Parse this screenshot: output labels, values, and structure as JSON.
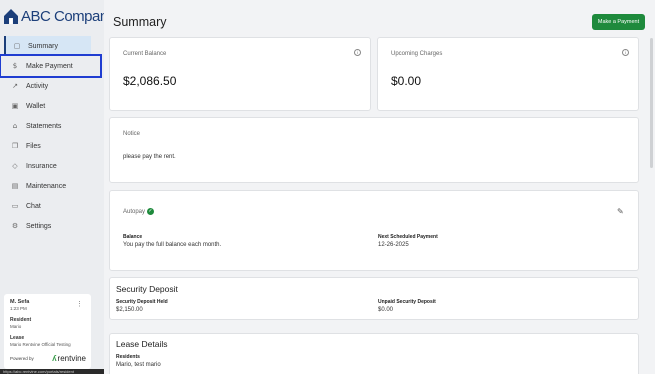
{
  "brand": {
    "name": "ABC Company",
    "color": "#1c3f7a"
  },
  "nav": [
    {
      "label": "Summary",
      "icon": "document-icon",
      "glyph": "▢",
      "state": "active"
    },
    {
      "label": "Make Payment",
      "icon": "dollar-circle-icon",
      "glyph": "$",
      "state": "focused"
    },
    {
      "label": "Activity",
      "icon": "trend-line-icon",
      "glyph": "↗",
      "state": ""
    },
    {
      "label": "Wallet",
      "icon": "wallet-icon",
      "glyph": "▣",
      "state": ""
    },
    {
      "label": "Statements",
      "icon": "bank-icon",
      "glyph": "⌂",
      "state": ""
    },
    {
      "label": "Files",
      "icon": "files-icon",
      "glyph": "❐",
      "state": ""
    },
    {
      "label": "Insurance",
      "icon": "shield-icon",
      "glyph": "◇",
      "state": ""
    },
    {
      "label": "Maintenance",
      "icon": "toolbox-icon",
      "glyph": "▤",
      "state": ""
    },
    {
      "label": "Chat",
      "icon": "chat-icon",
      "glyph": "▭",
      "state": ""
    },
    {
      "label": "Settings",
      "icon": "settings-icon",
      "glyph": "⚙",
      "state": ""
    }
  ],
  "user": {
    "name": "M. Sefa",
    "time": "1:23 PM",
    "resident_label": "Resident",
    "resident": "Mario",
    "lease_label": "Lease",
    "lease": "Mario Rentvine Official Testing",
    "powered_by": "Powered by",
    "powered_brand": "rentvine"
  },
  "status_url": "https://abc.rentvine.com/portals/resident",
  "page": {
    "title": "Summary",
    "make_payment_label": "Make a Payment"
  },
  "balance": {
    "label": "Current Balance",
    "amount": "$2,086.50"
  },
  "upcoming": {
    "label": "Upcoming Charges",
    "amount": "$0.00"
  },
  "notice": {
    "label": "Notice",
    "text": "please pay the rent."
  },
  "autopay": {
    "label": "Autopay",
    "balance_label": "Balance",
    "balance_text": "You pay the full balance each month.",
    "next_label": "Next Scheduled Payment",
    "next_date": "12-26-2025"
  },
  "deposit": {
    "title": "Security Deposit",
    "held_label": "Security Deposit Held",
    "held": "$2,150.00",
    "unpaid_label": "Unpaid Security Deposit",
    "unpaid": "$0.00"
  },
  "lease_details": {
    "title": "Lease Details",
    "residents_label": "Residents",
    "residents": "Mario, test mario"
  },
  "colors": {
    "accent_green": "#1e8a3c",
    "focus_outline": "#1f3dd1",
    "active_bg": "#d6e6f5"
  }
}
